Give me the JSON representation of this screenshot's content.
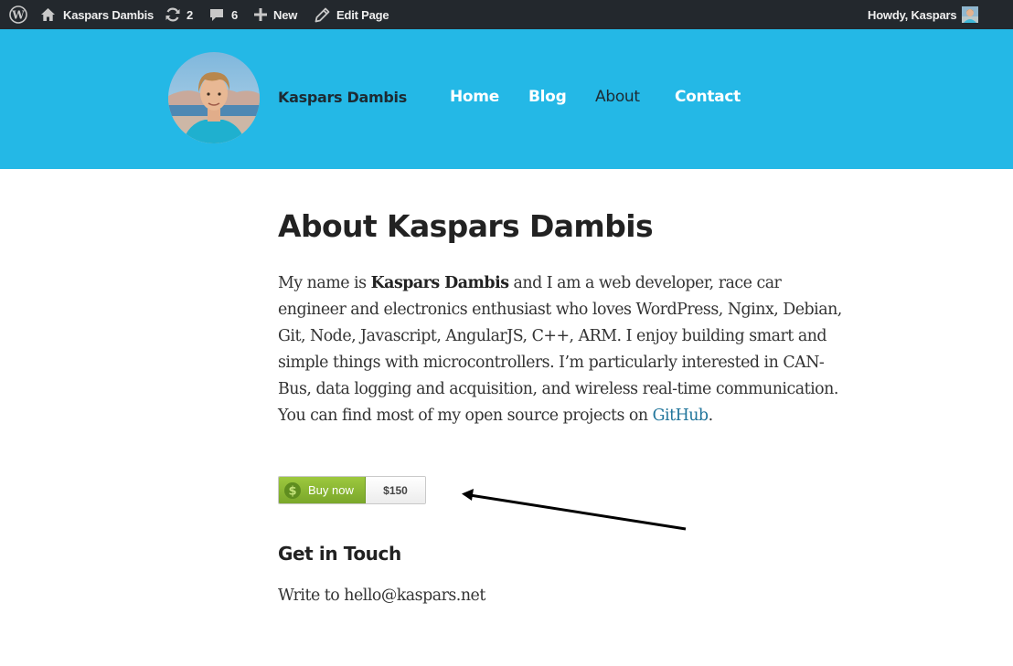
{
  "admin_bar": {
    "site_name": "Kaspars Dambis",
    "updates_count": "2",
    "comments_count": "6",
    "new_label": "New",
    "edit_label": "Edit Page",
    "greeting": "Howdy, Kaspars",
    "icons": [
      "wordpress-logo-icon",
      "home-icon",
      "updates-icon",
      "comments-icon",
      "plus-icon",
      "pencil-icon",
      "user-avatar-icon"
    ]
  },
  "header": {
    "site_title": "Kaspars Dambis",
    "nav": [
      {
        "label": "Home",
        "current": false
      },
      {
        "label": "Blog",
        "current": false
      },
      {
        "label": "About",
        "current": true
      },
      {
        "label": "Contact",
        "current": false
      }
    ],
    "bg_color": "#24b8e6"
  },
  "content": {
    "title": "About Kaspars Dambis",
    "intro": {
      "before_bold": "My name is ",
      "bold": "Kaspars Dambis",
      "after_bold": " and I am a web developer, race car engineer and electronics enthusiast who loves WordPress, Nginx, Debian, Git, Node, Javascript, AngularJS, C++, ARM. I enjoy building smart and simple things with microcontrollers. I’m particularly interested in CAN-Bus, data logging and acquisition, and wireless real-time communication. You can find most of my open source projects on ",
      "link": "GitHub",
      "end": "."
    },
    "buy_widget": {
      "label": "Buy now",
      "price": "$150",
      "color": "#8cba34"
    },
    "touch_heading": "Get in Touch",
    "touch_text": "Write to hello@kaspars.net"
  }
}
